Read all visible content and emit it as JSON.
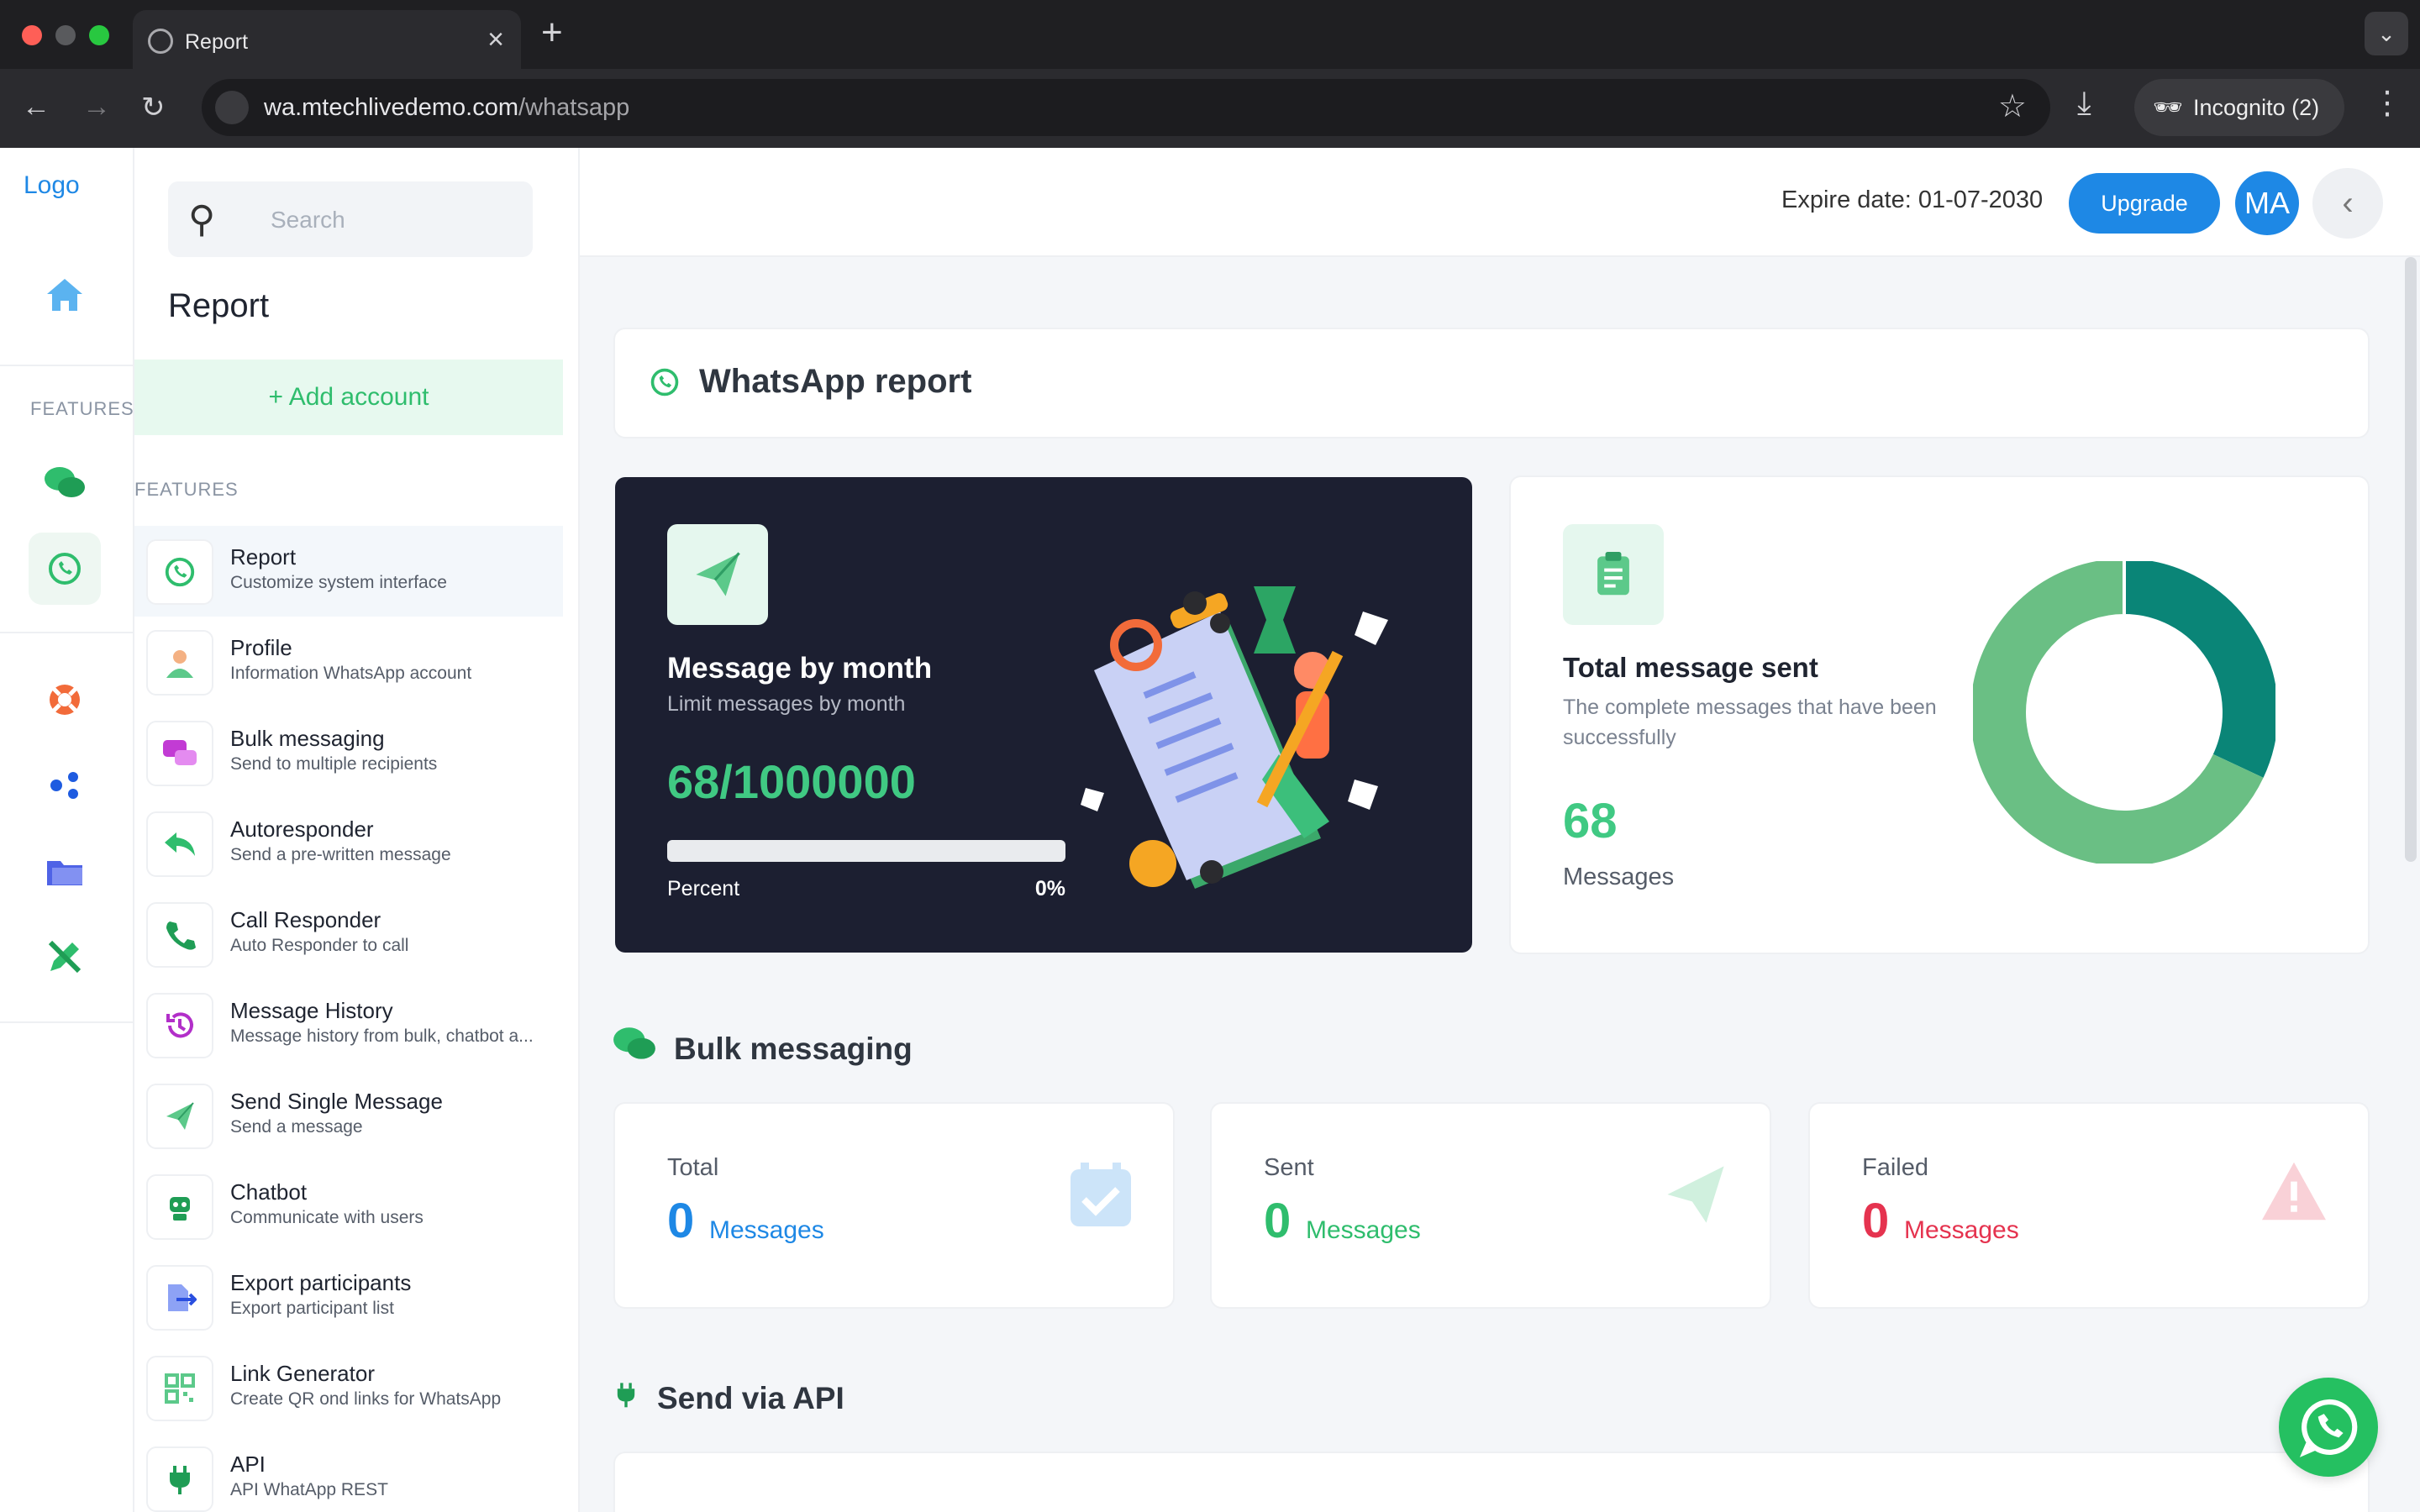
{
  "browser": {
    "tab_title": "Report",
    "url_host": "wa.mtechlivedemo.com",
    "url_path": "/whatsapp",
    "incognito_label": "Incognito (2)"
  },
  "rail": {
    "logo_alt": "Logo",
    "section_label": "FEATURES"
  },
  "sidebar": {
    "search_placeholder": "Search",
    "page_title": "Report",
    "add_account": "Add account",
    "features_label": "FEATURES",
    "items": [
      {
        "title": "Report",
        "subtitle": "Customize system interface",
        "icon": "whatsapp-icon"
      },
      {
        "title": "Profile",
        "subtitle": "Information WhatsApp account",
        "icon": "user-icon"
      },
      {
        "title": "Bulk messaging",
        "subtitle": "Send to multiple recipients",
        "icon": "chat-bubbles-icon"
      },
      {
        "title": "Autoresponder",
        "subtitle": "Send a pre-written message",
        "icon": "reply-icon"
      },
      {
        "title": "Call Responder",
        "subtitle": "Auto Responder to call",
        "icon": "phone-icon"
      },
      {
        "title": "Message History",
        "subtitle": "Message history from bulk, chatbot a...",
        "icon": "history-icon"
      },
      {
        "title": "Send Single Message",
        "subtitle": "Send a message",
        "icon": "paper-plane-icon"
      },
      {
        "title": "Chatbot",
        "subtitle": "Communicate with users",
        "icon": "robot-icon"
      },
      {
        "title": "Export participants",
        "subtitle": "Export participant list",
        "icon": "export-icon"
      },
      {
        "title": "Link Generator",
        "subtitle": "Create QR ond links for WhatsApp",
        "icon": "qr-icon"
      },
      {
        "title": "API",
        "subtitle": "API WhatApp REST",
        "icon": "plug-icon"
      }
    ]
  },
  "header": {
    "expire_label": "Expire date: 01-07-2030",
    "upgrade_label": "Upgrade",
    "avatar_initials": "MA"
  },
  "report": {
    "title": "WhatsApp report",
    "monthly": {
      "title": "Message by month",
      "subtitle": "Limit messages by month",
      "value": "68/1000000",
      "percent_label": "Percent",
      "percent_value": "0%",
      "progress_fraction": 6.8e-05
    },
    "total": {
      "title": "Total message sent",
      "subtitle": "The complete messages that have been successfully",
      "value": "68",
      "unit": "Messages",
      "donut_fraction": 0.32
    }
  },
  "bulk": {
    "section_title": "Bulk messaging",
    "stats": [
      {
        "label": "Total",
        "value": "0",
        "unit": "Messages",
        "color": "#1e88e5",
        "icon": "calendar-check-icon"
      },
      {
        "label": "Sent",
        "value": "0",
        "unit": "Messages",
        "color": "#2fbd6d",
        "icon": "paper-plane-icon"
      },
      {
        "label": "Failed",
        "value": "0",
        "unit": "Messages",
        "color": "#e5334f",
        "icon": "warning-icon"
      }
    ]
  },
  "api": {
    "section_title": "Send via API"
  },
  "colors": {
    "brand_green": "#2fbd6d",
    "accent_blue": "#1e88e5",
    "dark_card": "#1c1f31",
    "donut_dark": "#0a8577",
    "donut_light": "#6abf84"
  }
}
